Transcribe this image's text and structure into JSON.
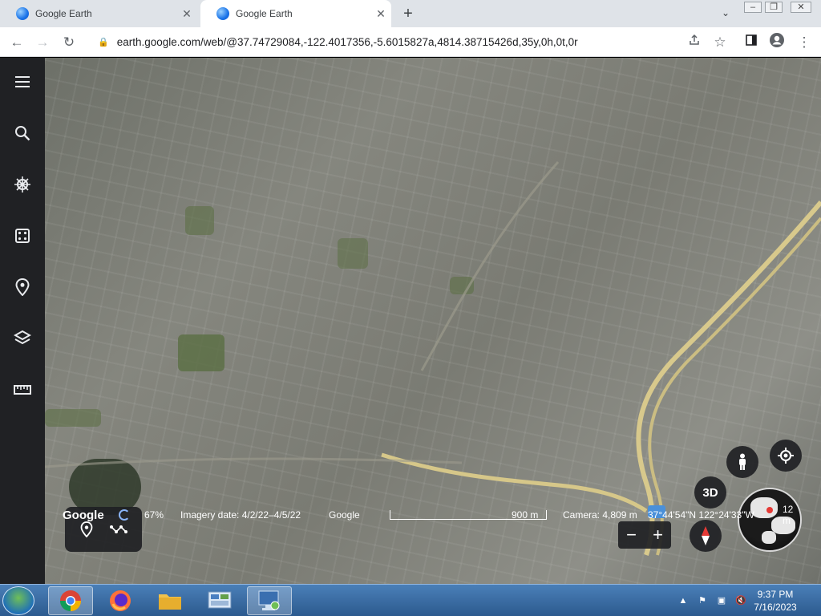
{
  "browser": {
    "tabs": [
      {
        "title": "Google Earth",
        "active": false
      },
      {
        "title": "Google Earth",
        "active": true
      }
    ],
    "new_tab_symbol": "+",
    "address": "earth.google.com/web/@37.74729084,-122.4017356,-5.6015827a,4814.38715426d,35y,0h,0t,0r",
    "window_controls": [
      "minimize",
      "restore",
      "close"
    ]
  },
  "rail": {
    "items": [
      {
        "name": "menu-icon"
      },
      {
        "name": "search-icon"
      },
      {
        "name": "voyager-icon"
      },
      {
        "name": "random-icon"
      },
      {
        "name": "projects-icon"
      },
      {
        "name": "map-style-icon"
      },
      {
        "name": "measure-icon"
      }
    ]
  },
  "map": {
    "tools": [
      "placemark-icon",
      "path-icon"
    ],
    "btn_3d": "3D",
    "zoom_out": "−",
    "zoom_in": "+"
  },
  "status": {
    "logo": "Google",
    "progress_pct": "67%",
    "imagery_date": "Imagery date: 4/2/22–4/5/22",
    "attribution": "Google",
    "scale": "900 m",
    "camera": "Camera: 4,809 m",
    "coords": "37°44'54\"N 122°24'33\"W",
    "elevation": "12 m"
  },
  "taskbar": {
    "apps": [
      "chrome",
      "firefox",
      "file-explorer",
      "control-panel",
      "remote-desktop"
    ],
    "time": "9:37 PM",
    "date": "7/16/2023"
  },
  "colors": {
    "rail_bg": "#202124",
    "accent_blue": "#1a73e8",
    "taskbar": "#2c5a8e"
  }
}
